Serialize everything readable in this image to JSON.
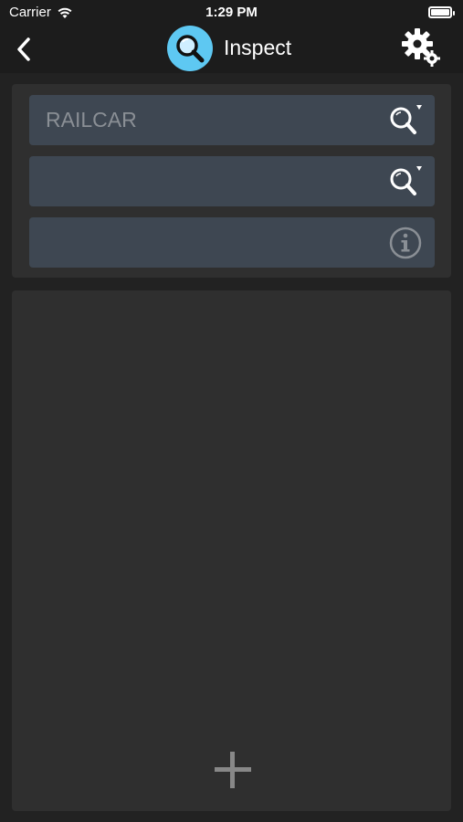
{
  "status_bar": {
    "carrier": "Carrier",
    "time": "1:29 PM",
    "wifi_icon": "wifi-icon",
    "battery_icon": "battery-icon"
  },
  "nav": {
    "title": "Inspect",
    "back_icon": "chevron-left-icon",
    "logo_icon": "magnifier-icon",
    "settings_icon": "gear-icon",
    "logo_color": "#5ec8f2"
  },
  "fields": [
    {
      "placeholder": "RAILCAR",
      "value": "",
      "icon": "search-dropdown-icon"
    },
    {
      "placeholder": "",
      "value": "",
      "icon": "search-dropdown-icon"
    },
    {
      "placeholder": "",
      "value": "",
      "icon": "info-icon"
    }
  ],
  "panel": {
    "add_icon": "plus-icon"
  },
  "colors": {
    "background": "#222222",
    "card": "#2f2f2f",
    "field": "#3e4752",
    "accent": "#5ec8f2"
  }
}
